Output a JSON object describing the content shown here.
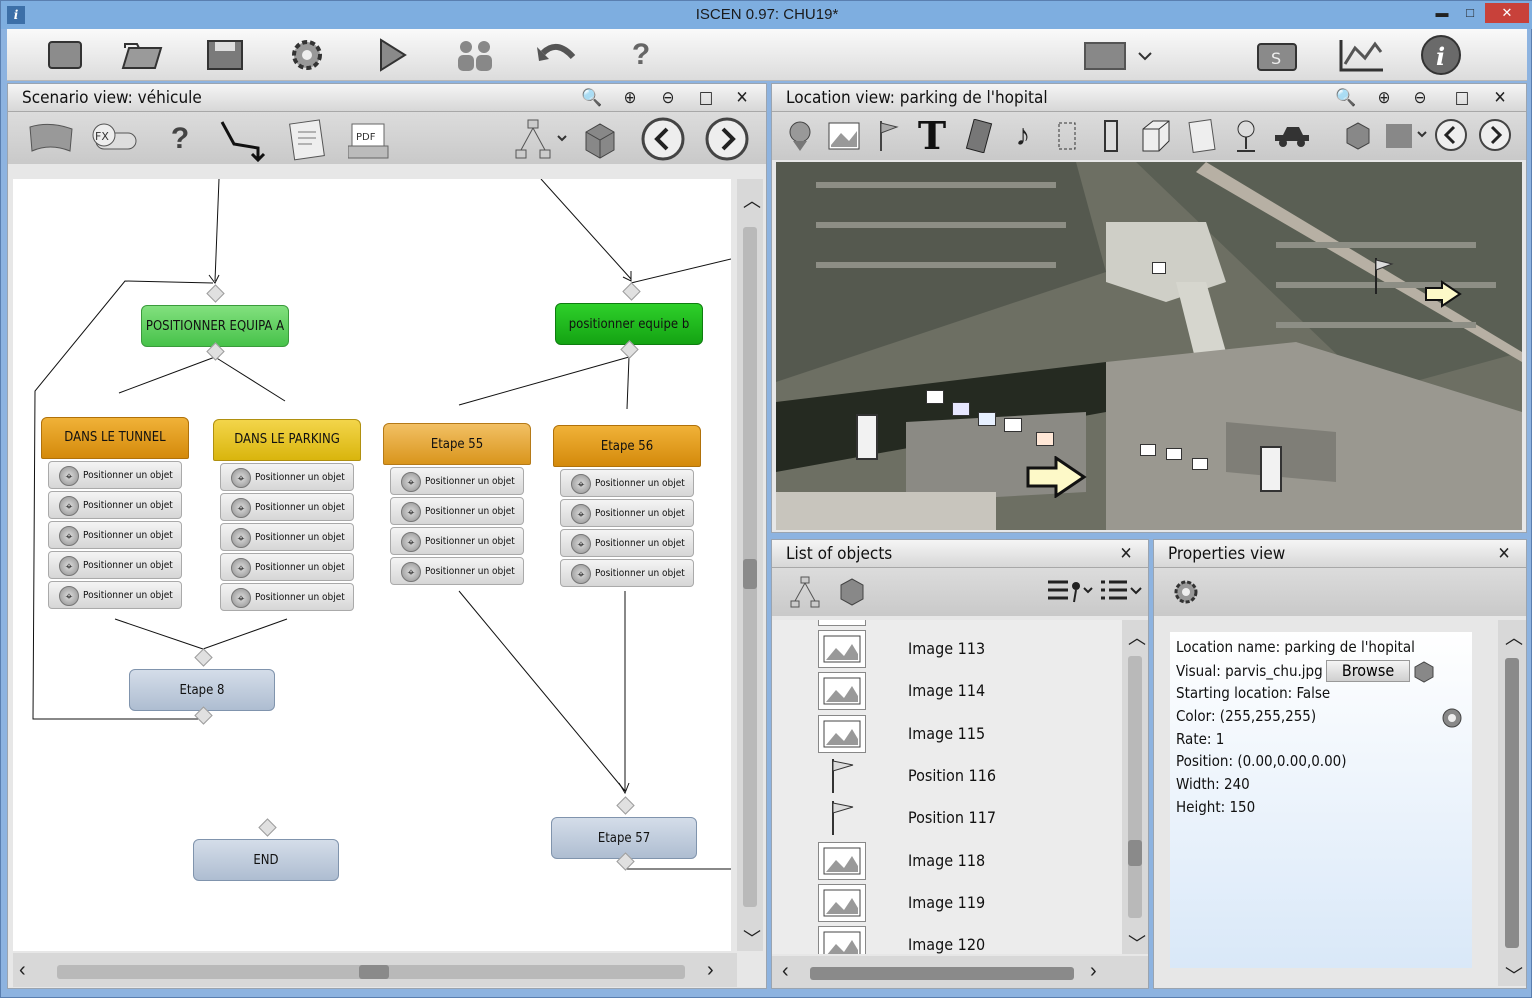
{
  "window": {
    "title": "ISCEN  0.97: CHU19*",
    "minimize": "▬",
    "maximize": "□",
    "close": "✕"
  },
  "toolbar": {
    "icons": [
      "new-icon",
      "open-icon",
      "save-icon",
      "settings-icon",
      "play-icon",
      "users-icon",
      "undo-icon",
      "help-icon",
      "window-list-icon",
      "scenario-export-icon",
      "stats-icon",
      "info-icon"
    ]
  },
  "scenario": {
    "title": "Scenario view: véhicule",
    "tools": {
      "fx": "FX",
      "pdf": "PDF",
      "help": "?"
    },
    "nodes": {
      "positionner_a": "POSITIONNER EQUIPA A",
      "positionner_b": "positionner  equipe  b",
      "tunnel": "DANS LE TUNNEL",
      "parking": "DANS LE PARKING",
      "etape55": "Etape 55",
      "etape56": "Etape 56",
      "etape8": "Etape 8",
      "etape57": "Etape 57",
      "end": "END"
    },
    "action_label": "Positionner un objet"
  },
  "location": {
    "title": "Location view: parking de l'hopital",
    "text_tool": "T"
  },
  "objects": {
    "title": "List of objects",
    "items": [
      {
        "label": "Image 113",
        "kind": "image"
      },
      {
        "label": "Image 114",
        "kind": "image"
      },
      {
        "label": "Image 115",
        "kind": "image"
      },
      {
        "label": "Position 116",
        "kind": "flag"
      },
      {
        "label": "Position 117",
        "kind": "flag"
      },
      {
        "label": "Image 118",
        "kind": "image"
      },
      {
        "label": "Image 119",
        "kind": "image"
      },
      {
        "label": "Image 120",
        "kind": "image"
      }
    ]
  },
  "properties": {
    "title": "Properties view",
    "location_name": "Location name: parking de l'hopital",
    "visual": "Visual: parvis_chu.jpg",
    "browse": "Browse",
    "starting": "Starting location: False",
    "color": "Color: (255,255,255)",
    "rate": "Rate:  1",
    "position": "Position: (0.00,0.00,0.00)",
    "width": "Width:  240",
    "height": "Height:  150"
  },
  "colors": {
    "accent": "#7eaee0",
    "green": "#47c24a",
    "orange": "#d48a0b",
    "blue_step": "#aebdd1"
  }
}
